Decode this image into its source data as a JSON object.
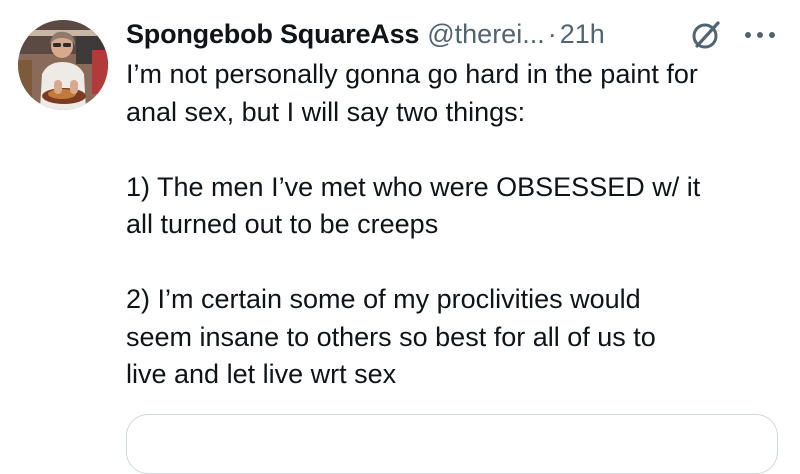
{
  "tweet": {
    "display_name": "Spongebob SquareAss",
    "handle": "@therei...",
    "separator": "·",
    "time": "21h",
    "text_lines": {
      "p1_l1": "I’m not personally gonna go hard in the paint for",
      "p1_l2": "anal sex, but I will say two things:",
      "p2_l1": "1) The men I’ve met who were OBSESSED w/ it",
      "p2_l2": "all turned out to be creeps",
      "p3_l1": "2) I’m certain some of my proclivities would",
      "p3_l2": "seem insane to others so best for all of us to",
      "p3_l3": "live and let live wrt sex"
    }
  },
  "icons": {
    "avatar": "avatar",
    "grok": "grok-icon",
    "more": "more-options-icon"
  },
  "colors": {
    "primary_text": "#0f1419",
    "secondary_text": "#536471",
    "border": "#cfd9de"
  }
}
